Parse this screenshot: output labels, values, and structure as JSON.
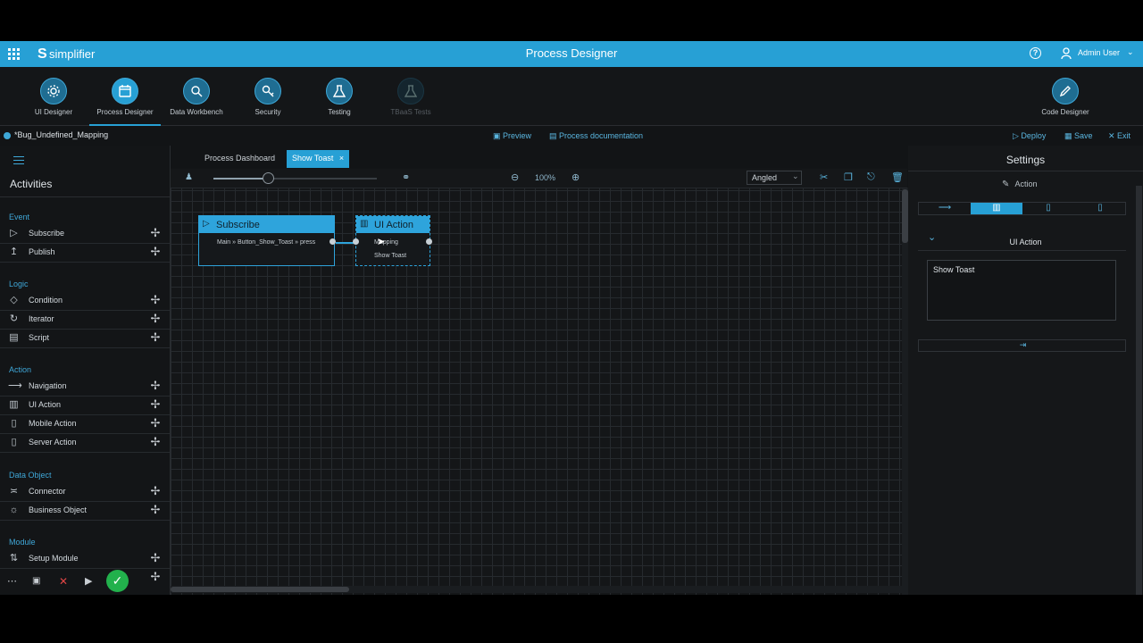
{
  "topbar": {
    "brand": "simplifier",
    "title": "Process Designer",
    "user": "Admin User"
  },
  "nav": [
    {
      "label": "UI Designer",
      "icon": "gear-cube-icon"
    },
    {
      "label": "Process Designer",
      "icon": "calendar-icon",
      "active": true
    },
    {
      "label": "Data Workbench",
      "icon": "wrench-magnifier-icon"
    },
    {
      "label": "Security",
      "icon": "key-icon"
    },
    {
      "label": "Testing",
      "icon": "flask-icon"
    },
    {
      "label": "TBaaS Tests",
      "icon": "flask-icon",
      "disabled": true
    },
    {
      "label": "Code Designer",
      "icon": "pen-icon"
    }
  ],
  "subbar": {
    "process_name": "*Bug_Undefined_Mapping",
    "preview": "Preview",
    "documentation": "Process documentation",
    "deploy": "Deploy",
    "save": "Save",
    "exit": "Exit"
  },
  "tabs": [
    {
      "label": "Process Dashboard"
    },
    {
      "label": "Show Toast",
      "close": "×"
    }
  ],
  "left": {
    "title": "Activities",
    "sections": [
      {
        "name": "Event",
        "items": [
          "Subscribe",
          "Publish"
        ]
      },
      {
        "name": "Logic",
        "items": [
          "Condition",
          "Iterator",
          "Script"
        ]
      },
      {
        "name": "Action",
        "items": [
          "Navigation",
          "UI Action",
          "Mobile Action",
          "Server Action"
        ]
      },
      {
        "name": "Data Object",
        "items": [
          "Connector",
          "Business Object"
        ]
      },
      {
        "name": "Module",
        "items": [
          "Setup Module"
        ]
      }
    ]
  },
  "toolbar": {
    "zoom": "100%",
    "connector_style": "Angled",
    "slider_value": 0.35
  },
  "canvas": {
    "subscribe_node": {
      "title": "Subscribe",
      "text": "Main » Button_Show_Toast » press"
    },
    "uiaction_node": {
      "title": "UI Action",
      "mapping": "Mapping",
      "text": "Show Toast"
    }
  },
  "settings": {
    "title": "Settings",
    "subtitle": "Action",
    "section": "UI Action",
    "textarea": "Show Toast"
  },
  "colors": {
    "accent": "#27a0d5",
    "bg": "#121416",
    "section": "#3fa7d8"
  }
}
